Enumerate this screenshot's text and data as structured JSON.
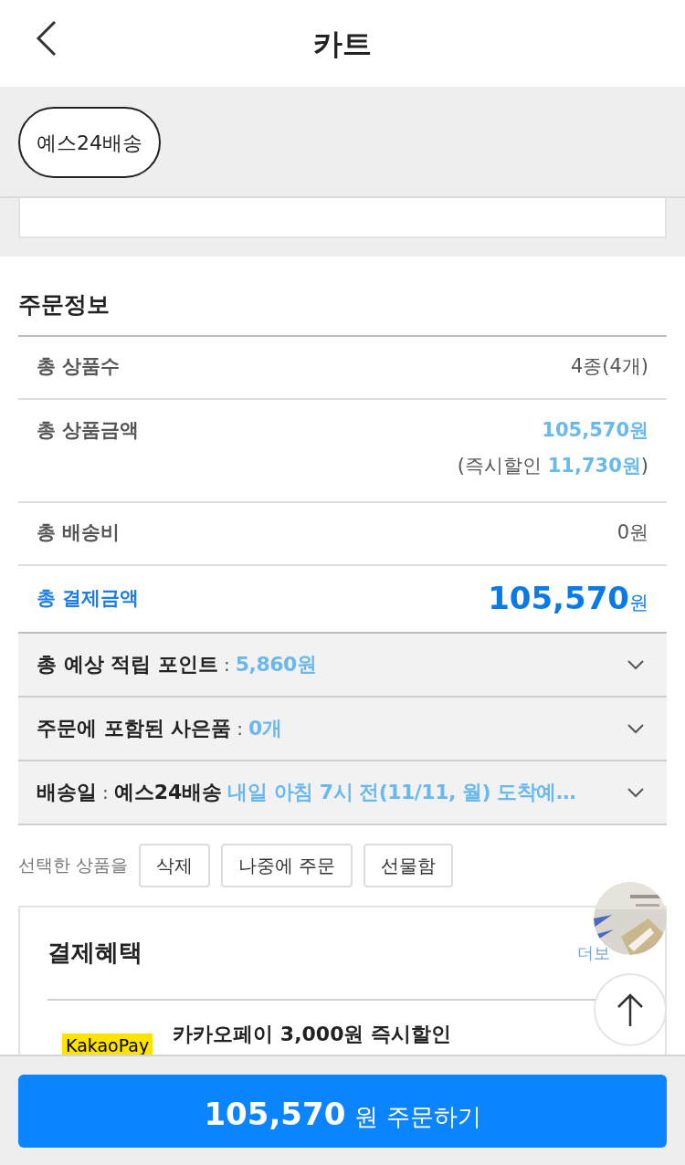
{
  "header": {
    "title": "카트"
  },
  "delivery_tabs": [
    {
      "label": "예스24배송",
      "selected": true
    }
  ],
  "order_info": {
    "title": "주문정보",
    "rows": [
      {
        "kind": "plain",
        "label": "총 상품수",
        "value": "4종(4개)"
      },
      {
        "kind": "discount",
        "label": "총 상품금액",
        "value": "105,570원",
        "note": "(즉시할인",
        "note_amount": "11,730원",
        "note_end": ")"
      },
      {
        "kind": "plain",
        "label": "총 배송비",
        "value": "0원"
      },
      {
        "kind": "total",
        "label": "총 결제금액",
        "value": "105,570",
        "unit": "원"
      }
    ]
  },
  "expanders": [
    {
      "label": "총 예상 적립 포인트",
      "separator": ":",
      "value": "5,860원",
      "expanded": false
    },
    {
      "label": "주문에 포함된 사은품",
      "separator": ":",
      "value": "0개",
      "expanded": false
    },
    {
      "label": "배송일",
      "separator": ":",
      "extra": "예스24배송",
      "value": "내일 아침 7시 전(11/11, 월) 도착예…",
      "expanded": false
    }
  ],
  "selected_actions": {
    "label": "선택한 상품을",
    "buttons": [
      "삭제",
      "나중에 주문",
      "선물함"
    ]
  },
  "benefits": {
    "title": "결제혜택",
    "more": "더보",
    "items": [
      {
        "logo": "KakaoPay",
        "title": "카카오페이 3,000원 즉시할인"
      }
    ]
  },
  "order_button": {
    "amount": "105,570",
    "label": "원 주문하기"
  }
}
